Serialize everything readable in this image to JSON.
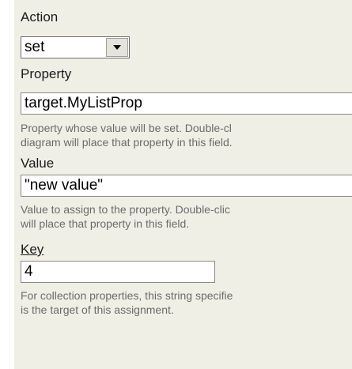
{
  "action": {
    "label": "Action",
    "selected": "set"
  },
  "property": {
    "label": "Property",
    "value": "target.MyListProp",
    "help_line1": "Property whose value will be set. Double-cl",
    "help_line2": "diagram will place that property in this field."
  },
  "value": {
    "label": "Value",
    "value": "\"new value\"",
    "help_line1": "Value to assign to the property. Double-clic",
    "help_line2": "will place that property in this field."
  },
  "key": {
    "label": "Key",
    "value": "4",
    "help_line1": "For collection properties, this string specifie",
    "help_line2": "is the target of this assignment."
  },
  "icons": {
    "dropdown": "chevron-down-icon"
  },
  "colors": {
    "panel_background": "#f0efe6",
    "help_text": "#6b6b6b",
    "input_border": "#8a8a8a"
  }
}
